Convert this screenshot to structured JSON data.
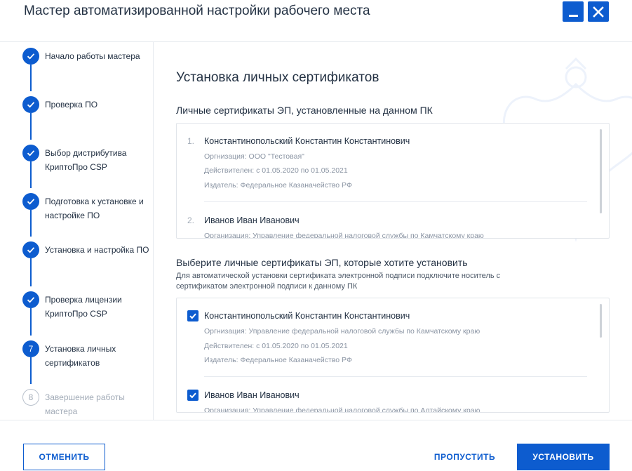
{
  "header": {
    "title": "Мастер автоматизированной настройки рабочего места",
    "minimize_icon": "minimize-icon",
    "close_icon": "close-icon",
    "accent_color": "#0d5ccf"
  },
  "steps": [
    {
      "label": "Начало работы мастера",
      "status": "done",
      "icon": "check-icon"
    },
    {
      "label": "Проверка ПО",
      "status": "done",
      "icon": "check-icon"
    },
    {
      "label": "Выбор дистрибутива КриптоПро CSP",
      "status": "done",
      "icon": "check-icon"
    },
    {
      "label": "Подготовка к установке и настройке ПО",
      "status": "done",
      "icon": "check-icon"
    },
    {
      "label": "Установка и настройка ПО",
      "status": "done",
      "icon": "check-icon"
    },
    {
      "label": "Проверка лицензии КриптоПро CSP",
      "status": "done",
      "icon": "check-icon"
    },
    {
      "label": "Установка личных сертификатов",
      "status": "current",
      "number": "7"
    },
    {
      "label": "Завершение работы мастера",
      "status": "pending",
      "number": "8"
    }
  ],
  "main": {
    "section_title": "Установка личных сертификатов",
    "installed": {
      "heading": "Личные сертификаты ЭП, установленные на данном ПК",
      "items": [
        {
          "number": "1.",
          "name": "Константинопольский Константин Константинович",
          "org": "Оргнизация: ООО \"Тестовая\"",
          "valid": "Действителен: с 01.05.2020 по 01.05.2021",
          "issuer": "Издатель: Федеральное Казаначейство РФ"
        },
        {
          "number": "2.",
          "name": "Иванов Иван Иванович",
          "org": "Организация: Управление федеральной налоговой службы по Камчатскому краю"
        }
      ]
    },
    "select": {
      "heading": "Выберите личные сертификаты ЭП, которые хотите установить",
      "hint": "Для автоматической установки сертификата электронной подписи подключите носитель с сертификатом электронной подписи к данному ПК",
      "items": [
        {
          "checked": true,
          "name": "Константинопольский Константин Константинович",
          "org": "Оргнизация: Управление федеральной налоговой службы по Камчатскому краю",
          "valid": "Действителен: с 01.05.2020 по 01.05.2021",
          "issuer": "Издатель: Федеральное Казаначейство РФ"
        },
        {
          "checked": true,
          "name": "Иванов Иван Иванович",
          "org": "Организация: Управление федеральной налоговой службы по Алтайскому краю"
        }
      ]
    }
  },
  "footer": {
    "cancel_label": "ОТМЕНИТЬ",
    "skip_label": "ПРОПУСТИТЬ",
    "install_label": "УСТАНОВИТЬ"
  }
}
